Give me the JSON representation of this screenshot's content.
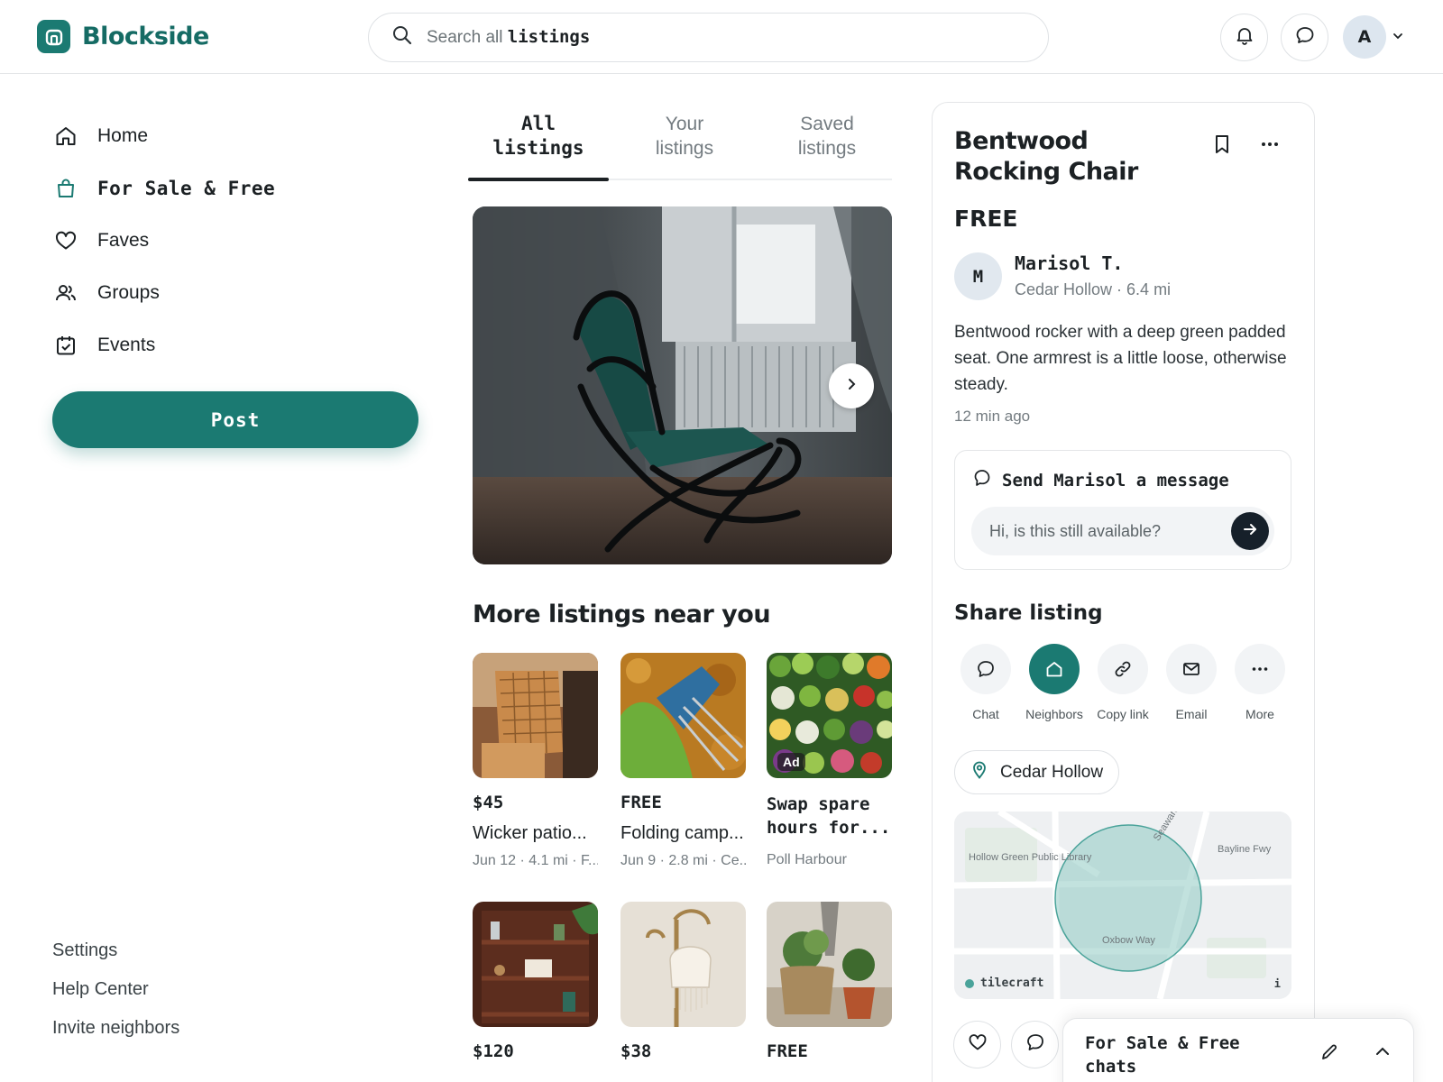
{
  "app": {
    "name": "Blockside",
    "brand_color": "#1b7a72"
  },
  "header": {
    "search": {
      "prefix": "Search all",
      "keyword": "listings",
      "icon": "search-icon"
    },
    "notifications_icon": "bell-icon",
    "messages_icon": "chat-bubble-icon",
    "avatar_initial": "A"
  },
  "sidebar": {
    "items": [
      {
        "label": "Home",
        "icon": "home-icon",
        "active": false
      },
      {
        "label": "For Sale & Free",
        "icon": "shopping-bag-icon",
        "active": true
      },
      {
        "label": "Faves",
        "icon": "heart-icon",
        "active": false
      },
      {
        "label": "Groups",
        "icon": "people-icon",
        "active": false
      },
      {
        "label": "Events",
        "icon": "calendar-check-icon",
        "active": false
      }
    ],
    "post_label": "Post",
    "footer_links": [
      "Settings",
      "Help Center",
      "Invite neighbors"
    ]
  },
  "main": {
    "tabs": [
      {
        "line1": "All",
        "line2": "listings",
        "active": true
      },
      {
        "line1": "Your",
        "line2": "listings",
        "active": false
      },
      {
        "line1": "Saved",
        "line2": "listings",
        "active": false
      }
    ],
    "section_title": "More listings near you",
    "listings": [
      {
        "price": "$45",
        "title": "Wicker patio...",
        "meta": "Jun 12 · 4.1 mi · F...",
        "image": "wicker-chair"
      },
      {
        "price": "FREE",
        "title": "Folding camp...",
        "meta": "Jun 9 · 2.8 mi · Ce...",
        "image": "camp-chair"
      },
      {
        "price": null,
        "title": "Swap spare hours for...",
        "meta": "Poll Harbour",
        "badge": "Ad",
        "image": "vegetables"
      },
      {
        "price": "$120",
        "title": "",
        "meta": "",
        "image": "shelf"
      },
      {
        "price": "$38",
        "title": "",
        "meta": "",
        "image": "lamp"
      },
      {
        "price": "FREE",
        "title": "",
        "meta": "",
        "image": "plants"
      }
    ]
  },
  "detail": {
    "title": "Bentwood Rocking Chair",
    "price": "FREE",
    "seller": {
      "initial": "M",
      "name": "Marisol T.",
      "location": "Cedar Hollow · 6.4 mi"
    },
    "description": "Bentwood rocker with a deep green padded seat. One armrest is a little loose, otherwise steady.",
    "posted": "12 min ago",
    "message": {
      "heading": "Send Marisol a message",
      "placeholder": "Hi, is this still available?"
    },
    "share_title": "Share listing",
    "share_options": [
      {
        "label": "Chat",
        "icon": "chat-bubble-icon"
      },
      {
        "label": "Neighbors",
        "icon": "home-icon"
      },
      {
        "label": "Copy link",
        "icon": "link-icon"
      },
      {
        "label": "Email",
        "icon": "mail-icon"
      },
      {
        "label": "More",
        "icon": "ellipsis-icon"
      }
    ],
    "location_chip": "Cedar Hollow",
    "map": {
      "labels": [
        "Hollow Green Public Library",
        "Seaward Way",
        "Bayline Fwy",
        "Oxbow Way"
      ],
      "attribution": "tilecraft",
      "info": "i"
    }
  },
  "chat_dock": {
    "title": "For Sale & Free chats"
  }
}
